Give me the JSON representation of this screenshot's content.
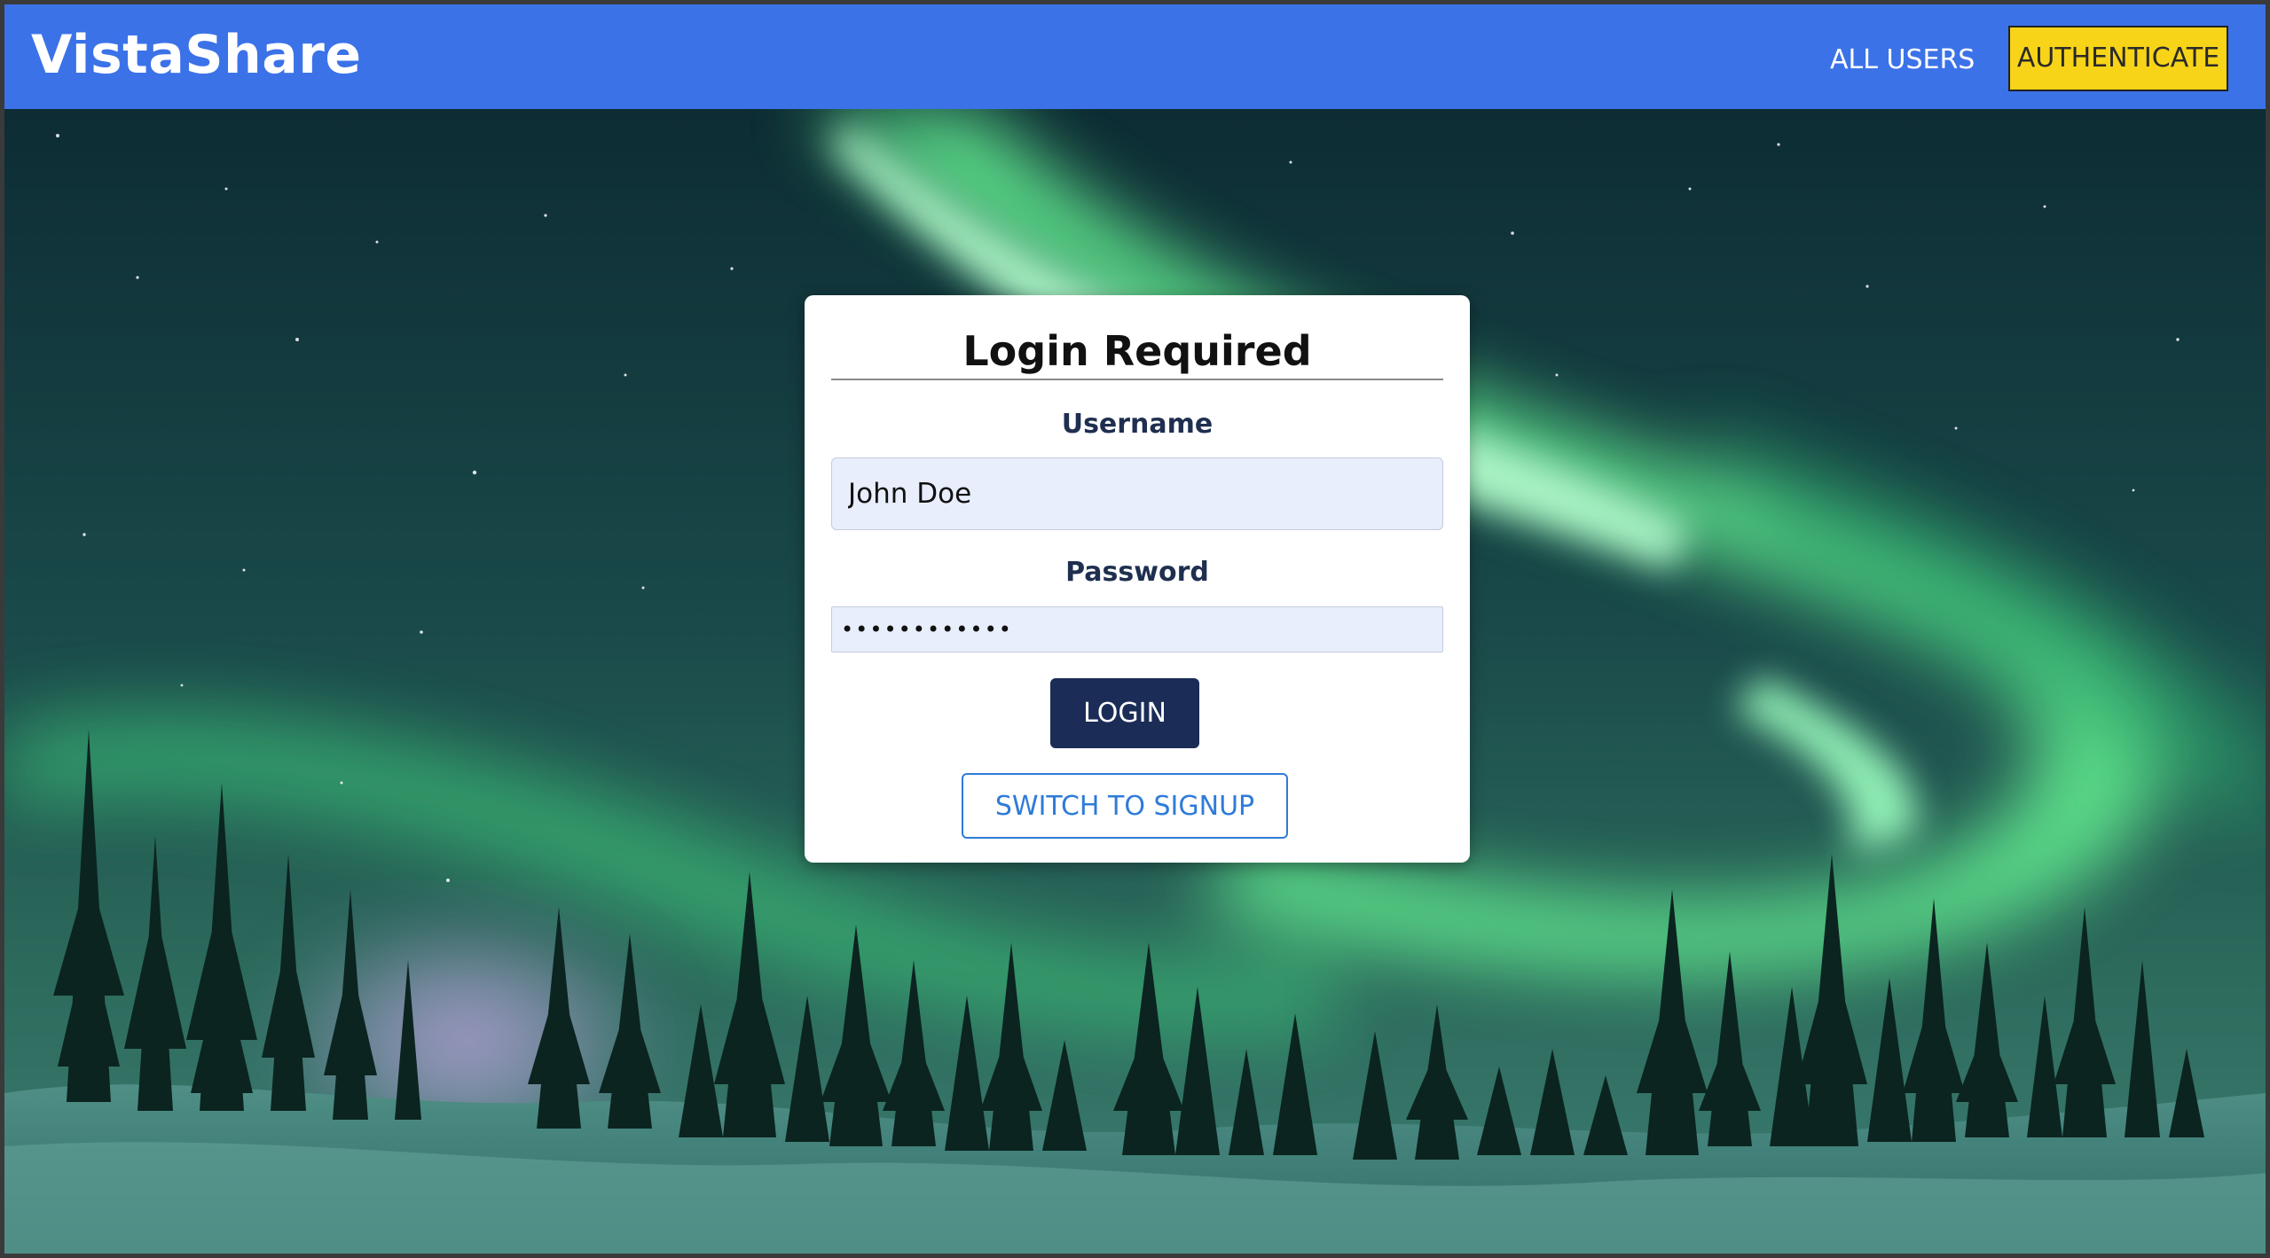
{
  "header": {
    "brand": "VistaShare",
    "nav": {
      "all_users": "ALL USERS",
      "authenticate": "AUTHENTICATE"
    }
  },
  "login": {
    "title": "Login Required",
    "username_label": "Username",
    "username_value": "John Doe",
    "password_label": "Password",
    "password_value": "••••••••••••",
    "login_button": "LOGIN",
    "switch_button": "SWITCH TO SIGNUP"
  },
  "colors": {
    "header_bg": "#3b72e8",
    "authenticate_bg": "#f7d417",
    "login_button_bg": "#1b2d57",
    "signup_accent": "#2f7bd8",
    "input_bg": "#e8eefb"
  },
  "background": {
    "description_icon": "aurora-forest-image"
  }
}
